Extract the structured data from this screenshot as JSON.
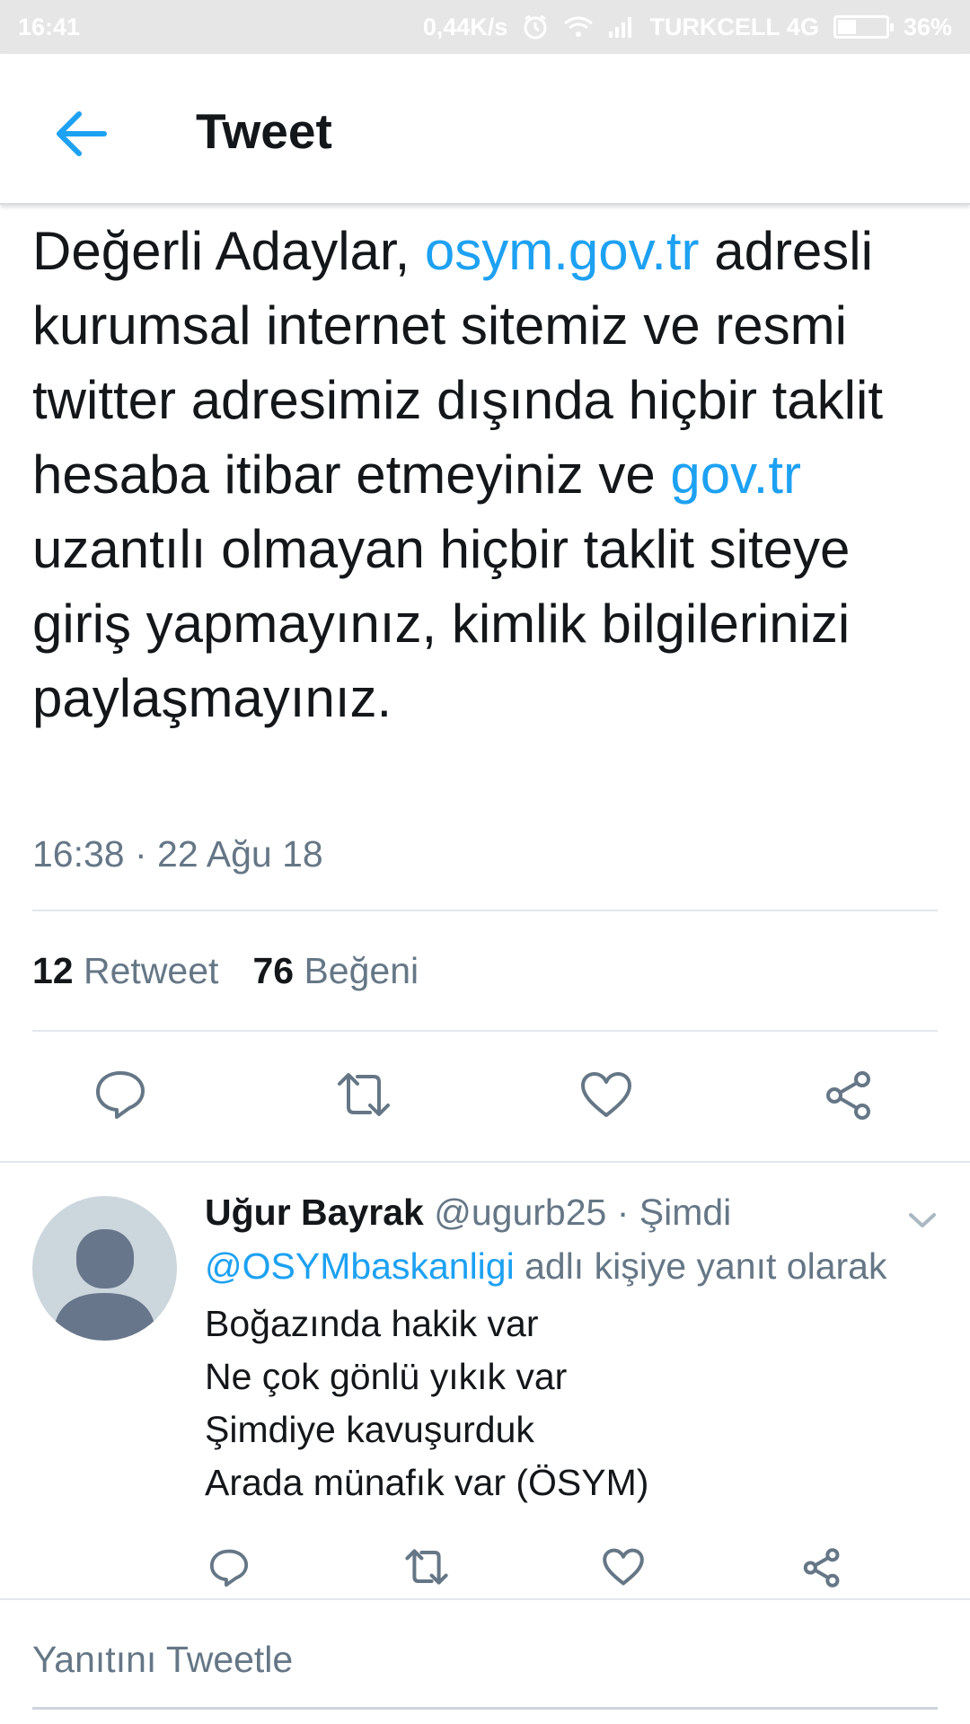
{
  "status_bar": {
    "time": "16:41",
    "net_speed": "0,44K/s",
    "carrier": "TURKCELL 4G",
    "battery": "36%",
    "battery_level": 0.36
  },
  "app_bar": {
    "title": "Tweet",
    "back_icon": "arrow-left-icon"
  },
  "tweet": {
    "text_segments": [
      {
        "text": "Değerli Adaylar, ",
        "link": false
      },
      {
        "text": "osym.gov.tr",
        "link": true
      },
      {
        "text": " adresli kurumsal internet sitemiz ve resmi twitter adresimiz dışında hiçbir taklit hesaba itibar etmeyiniz ve ",
        "link": false
      },
      {
        "text": "gov.tr",
        "link": true
      },
      {
        "text": " uzantılı olmayan hiçbir taklit siteye giriş yapmayınız, kimlik bilgilerinizi paylaşmayınız.",
        "link": false
      }
    ],
    "timestamp": "16:38 · 22 Ağu 18",
    "retweet_count": "12",
    "retweet_label": "Retweet",
    "like_count": "76",
    "like_label": "Beğeni"
  },
  "reply": {
    "name": "Uğur Bayrak",
    "handle": "@ugurb25",
    "separator": " · ",
    "time": "Şimdi",
    "reply_to_handle": "@OSYMbaskanligi",
    "reply_to_suffix": " adlı kişiye yanıt olarak",
    "lines": [
      "Boğazında hakik var",
      "Ne çok gönlü yıkık var",
      "Şimdiye kavuşurduk",
      "Arada münafık var (ÖSYM)"
    ]
  },
  "compose": {
    "placeholder": "Yanıtını Tweetle"
  },
  "colors": {
    "accent": "#1da1f2",
    "secondary_text": "#657786",
    "primary_text": "#14171a",
    "divider": "#e1e8ed"
  }
}
